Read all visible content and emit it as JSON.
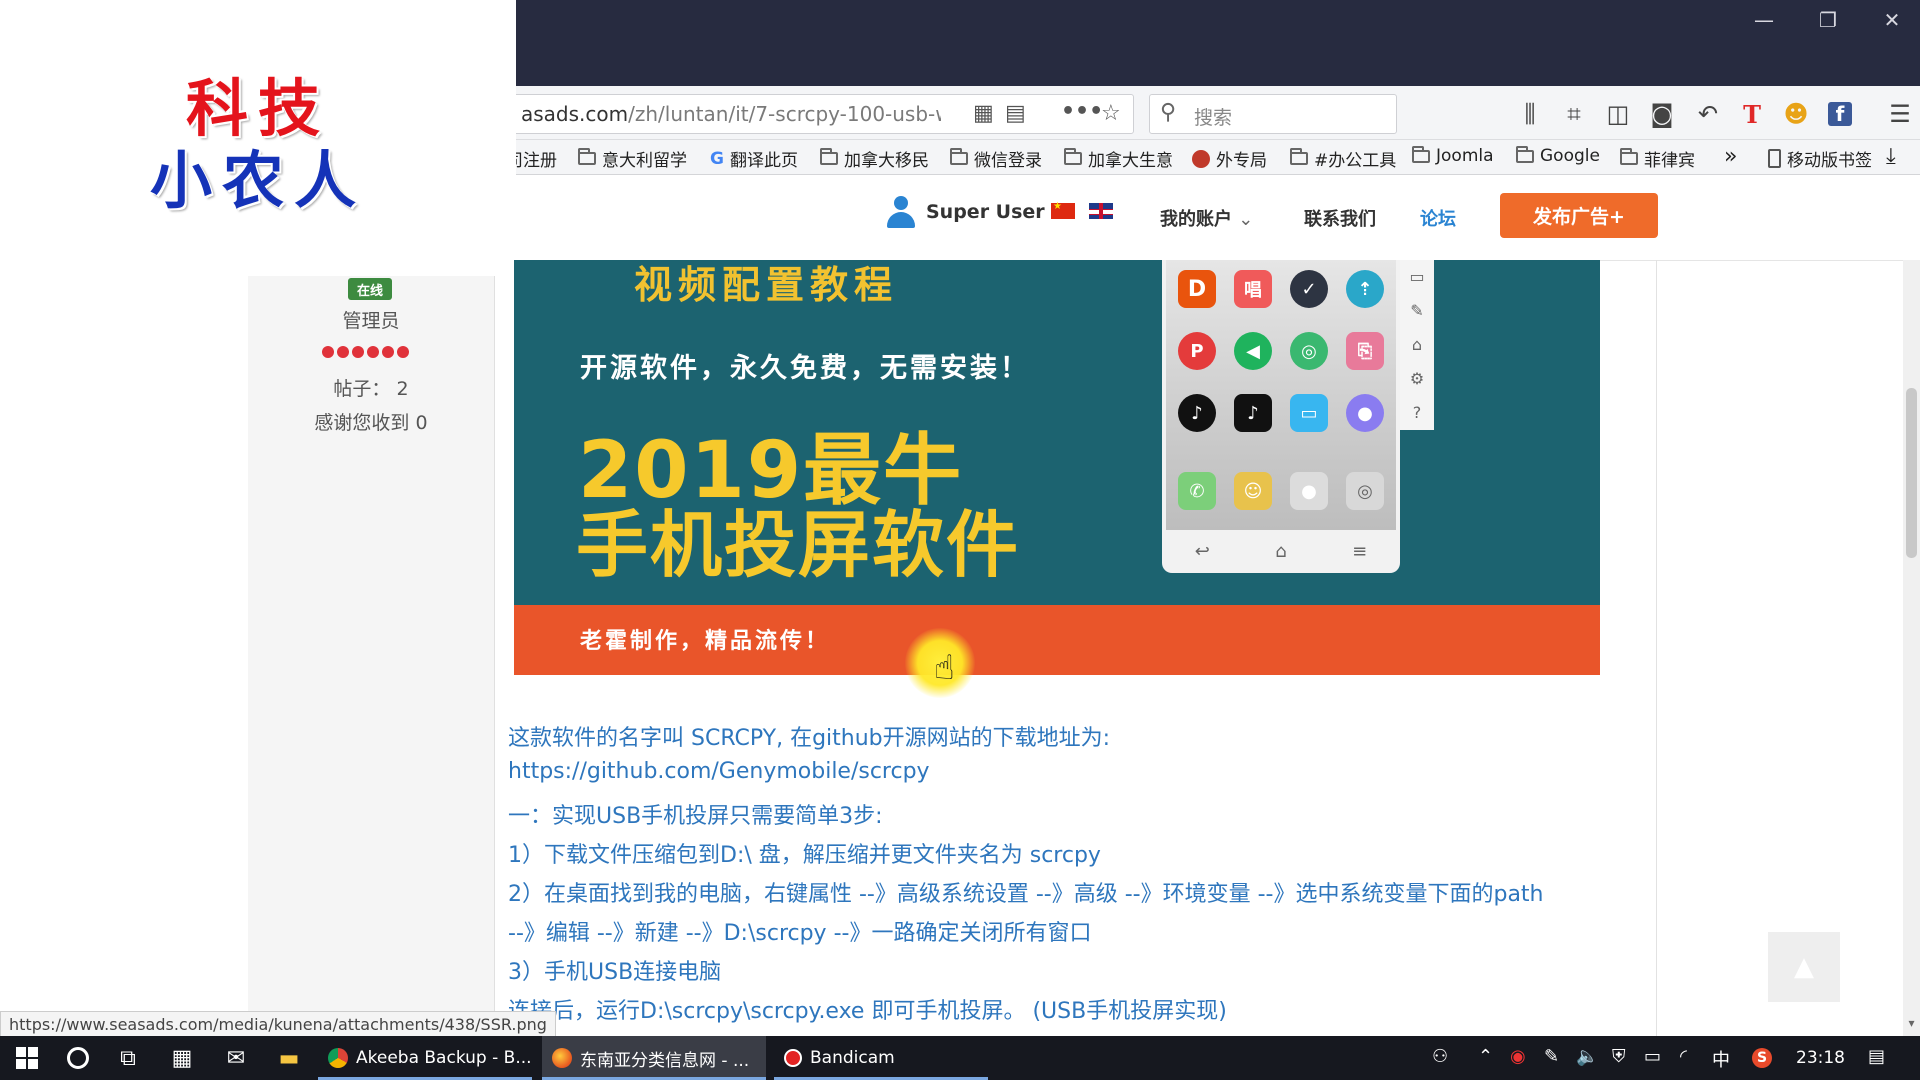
{
  "logo": {
    "line1": "科技",
    "line2": "小农人"
  },
  "browser": {
    "window_controls": {
      "minimize": "—",
      "restore": "❐",
      "close": "✕"
    },
    "url": {
      "domain": "asads.com",
      "path": "/zh/luntan/it/7-scrcpy-100-usb-wi"
    },
    "url_icons": {
      "qr": "▦",
      "reader": "▤",
      "more": "•••",
      "star": "☆"
    },
    "search": {
      "icon": "⚲",
      "placeholder": "搜索"
    },
    "toolbar_icons": [
      "library-icon",
      "crop-icon",
      "sidebar-icon",
      "extension-icon",
      "undo-icon",
      "t-icon",
      "emoji-icon",
      "facebook-icon",
      "menu-icon"
    ],
    "toolbar_glyphs": {
      "library": "⫼",
      "crop": "⌗",
      "sidebar": "◫",
      "ext": "◙",
      "undo": "↶",
      "t": "T",
      "emoji": "☻",
      "fb": "f",
      "menu": "☰"
    },
    "bookmarks": [
      {
        "label": "司注册",
        "icon": "none"
      },
      {
        "label": "意大利留学",
        "icon": "folder-icon"
      },
      {
        "label": "翻译此页",
        "icon": "google-icon"
      },
      {
        "label": "加拿大移民",
        "icon": "folder-icon"
      },
      {
        "label": "微信登录",
        "icon": "folder-icon"
      },
      {
        "label": "加拿大生意",
        "icon": "folder-icon"
      },
      {
        "label": "外专局",
        "icon": "site-icon"
      },
      {
        "label": "#办公工具",
        "icon": "folder-icon"
      },
      {
        "label": "Joomla",
        "icon": "folder-icon"
      },
      {
        "label": "Google",
        "icon": "folder-icon"
      },
      {
        "label": "菲律宾",
        "icon": "folder-icon"
      }
    ],
    "bookmarks_overflow": "»",
    "mobile_bookmarks": "移动版书签",
    "download_icon": "⤓"
  },
  "site": {
    "username": "Super User",
    "nav": {
      "account": "我的账户",
      "contact": "联系我们",
      "forum": "论坛"
    },
    "dropdown_glyph": "⌄",
    "post_ad": "发布广告+"
  },
  "author": {
    "status": "在线",
    "role": "管理员",
    "rating_dots": 6,
    "posts": "帖子： 2",
    "thanks": "感谢您收到 0"
  },
  "banner": {
    "top_text": "视频配置教程",
    "subtitle": "开源软件，永久免费，无需安装！",
    "year_line": "2019最牛",
    "title_line": "手机投屏软件",
    "footer": "老霍制作，精品流传！",
    "apps": [
      "D",
      "唱",
      "✓",
      "⇡",
      "P",
      "◀",
      "◎",
      "⎘",
      "♪",
      "♪",
      "▭",
      "●",
      "✆",
      "☺",
      "●",
      "◎"
    ],
    "phone_nav": [
      "↩",
      "⌂",
      "≡"
    ],
    "side_tools": [
      "▭",
      "✎",
      "⌂",
      "⚙",
      "?"
    ]
  },
  "article": {
    "p1": "这款软件的名字叫 SCRCPY, 在github开源网站的下载地址为:",
    "p2": "https://github.com/Genymobile/scrcpy",
    "p3": "一：实现USB手机投屏只需要简单3步:",
    "p4": "1）下载文件压缩包到D:\\ 盘，解压缩并更文件夹名为 scrcpy",
    "p5": "2）在桌面找到我的电脑，右键属性 --》高级系统设置 --》高级 --》环境变量 --》选中系统变量下面的path",
    "p6": "--》编辑 --》新建 --》D:\\scrcpy --》一路确定关闭所有窗口",
    "p7": "3）手机USB连接电脑",
    "p8": "连接后，运行D:\\scrcpy\\scrcpy.exe 即可手机投屏。   (USB手机投屏实现)"
  },
  "status_url": "https://www.seasads.com/media/kunena/attachments/438/SSR.png",
  "taskbar": {
    "tasks": [
      {
        "label": "Akeeba Backup - B...",
        "icon": "chrome-icon"
      },
      {
        "label": "东南亚分类信息网 - ...",
        "icon": "firefox-icon"
      },
      {
        "label": "Bandicam",
        "icon": "bandicam-icon"
      }
    ],
    "tray": {
      "people": "⚇",
      "chevron": "⌃",
      "record": "◉",
      "pen": "✎",
      "volume": "🔈",
      "shield": "⛨",
      "battery": "▭",
      "wifi": "◜",
      "ime": "中",
      "sogou": "S",
      "time": "23:18",
      "notify": "▤"
    }
  }
}
